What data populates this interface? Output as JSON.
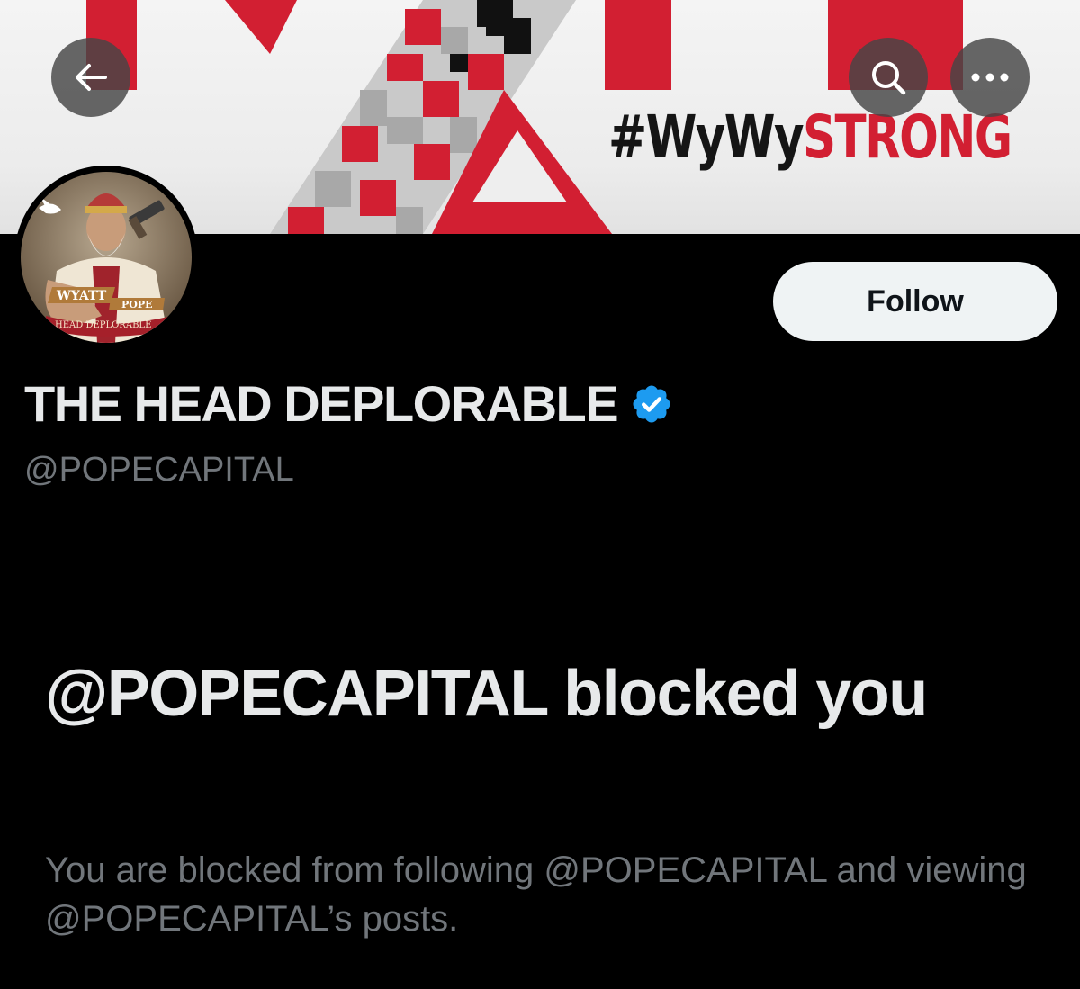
{
  "banner": {
    "hashtag_dark": "#WyWy",
    "hashtag_red": "STRONG",
    "colors": {
      "red": "#d21f32",
      "dark": "#151515",
      "background": "#eeeeee"
    }
  },
  "header": {
    "back_icon": "arrow-left-icon",
    "search_icon": "search-icon",
    "more_icon": "more-horizontal-icon"
  },
  "avatar": {
    "ribbon_text_1": "WYATT",
    "ribbon_text_2": "POPE",
    "ribbon_text_3": "HEAD DEPLORABLE"
  },
  "profile": {
    "display_name": "THE HEAD DEPLORABLE",
    "handle": "@POPECAPITAL",
    "verified": true,
    "verified_color": "#1d9bf0",
    "follow_label": "Follow"
  },
  "blocked": {
    "title": "@POPECAPITAL blocked you",
    "description": "You are blocked from following @POPECAPITAL and viewing @POPECAPITAL’s posts."
  }
}
